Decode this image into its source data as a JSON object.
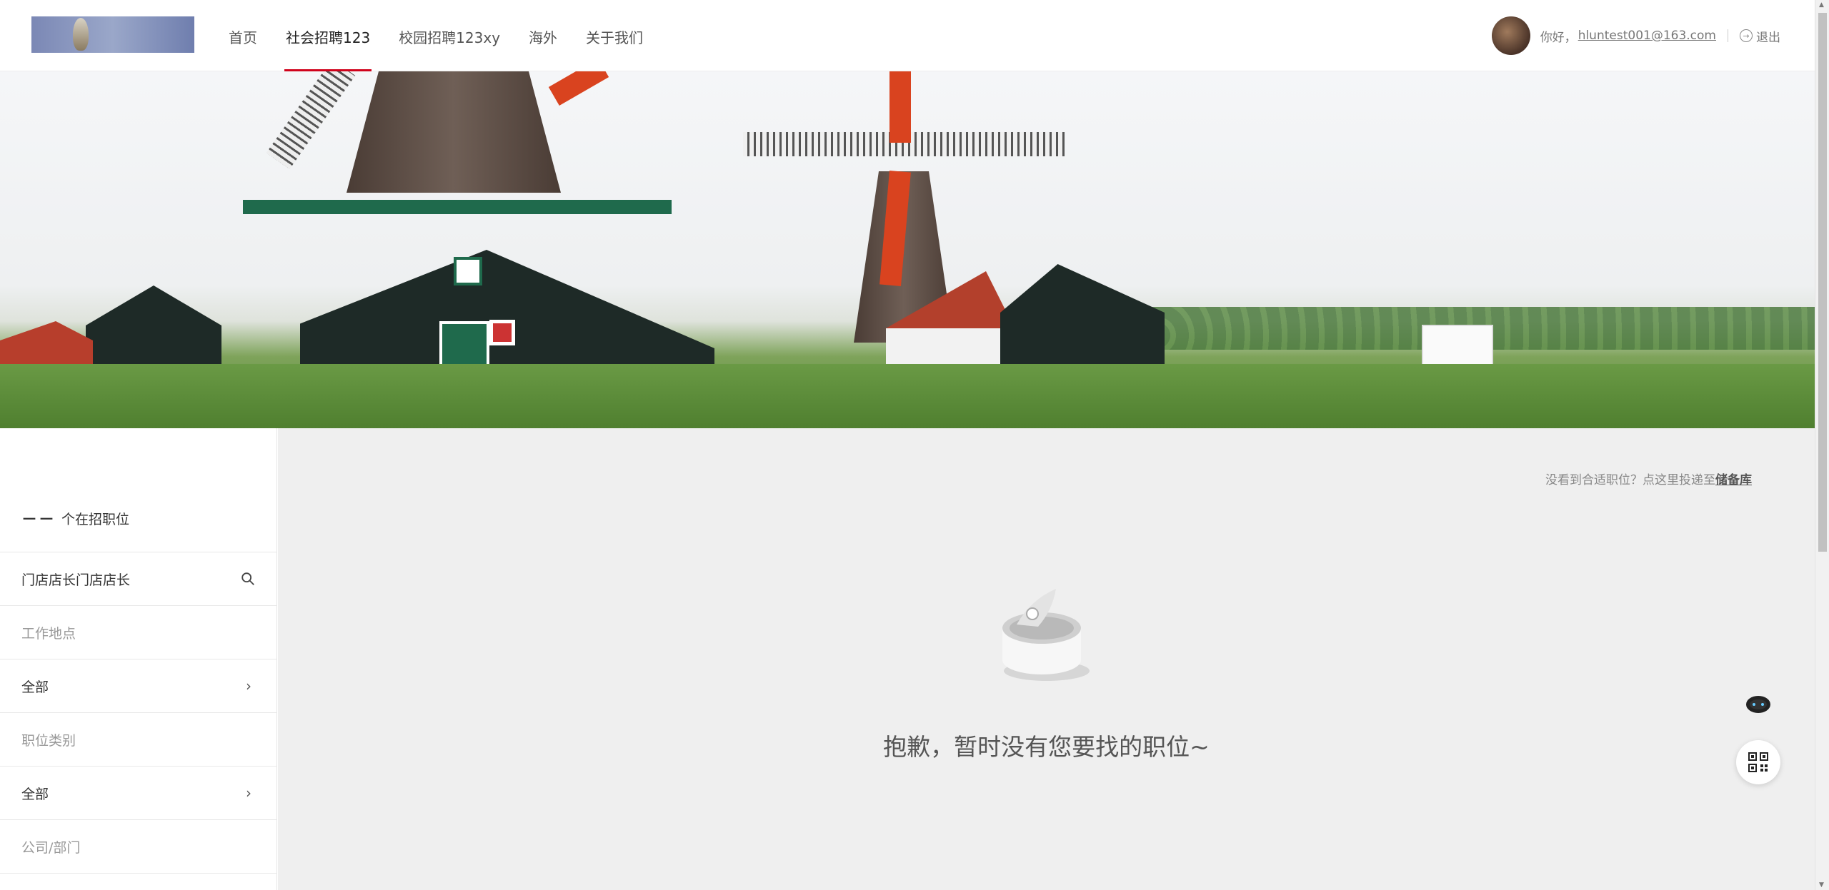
{
  "header": {
    "nav": [
      {
        "label": "首页",
        "active": false
      },
      {
        "label": "社会招聘123",
        "active": true
      },
      {
        "label": "校园招聘123xy",
        "active": false
      },
      {
        "label": "海外",
        "active": false
      },
      {
        "label": "关于我们",
        "active": false
      }
    ],
    "greeting": "你好，",
    "email": "hluntest001@163.com",
    "logout": "退出"
  },
  "sidebar": {
    "count_prefix": "－－",
    "count_label": "个在招职位",
    "search_value": "门店店长门店店长",
    "location_label": "工作地点",
    "location_value": "全部",
    "category_label": "职位类别",
    "category_value": "全部",
    "company_label": "公司/部门"
  },
  "main": {
    "tip_text": "没看到合适职位？点这里投递至",
    "tip_link": "储备库",
    "empty_text": "抱歉，暂时没有您要找的职位~"
  },
  "colors": {
    "accent": "#d0021b",
    "main_bg": "#efefef"
  },
  "icons": [
    "logo",
    "avatar",
    "logout-icon",
    "search-icon",
    "chevron-right-icon",
    "empty-box-icon",
    "robot-icon",
    "qr-code-icon"
  ]
}
